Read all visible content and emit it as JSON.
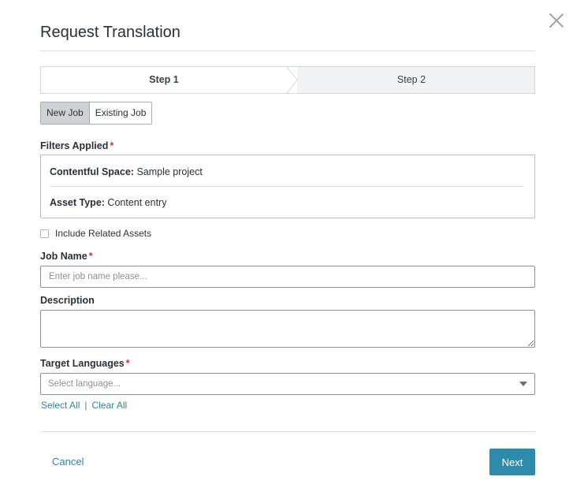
{
  "dialog": {
    "title": "Request Translation",
    "close_icon": "close-icon"
  },
  "steps": [
    {
      "label": "Step 1",
      "active": true
    },
    {
      "label": "Step 2",
      "active": false
    }
  ],
  "job_type_toggle": {
    "options": [
      "New Job",
      "Existing Job"
    ],
    "selected": "New Job"
  },
  "filters": {
    "label": "Filters Applied",
    "required_mark": "*",
    "rows": [
      {
        "key": "Contentful Space:",
        "value": "Sample project"
      },
      {
        "key": "Asset Type:",
        "value": "Content entry"
      }
    ]
  },
  "include_related": {
    "label": "Include Related Assets",
    "checked": false
  },
  "job_name": {
    "label": "Job Name",
    "required_mark": "*",
    "placeholder": "Enter job name please...",
    "value": ""
  },
  "description": {
    "label": "Description",
    "value": ""
  },
  "target_languages": {
    "label": "Target Languages",
    "required_mark": "*",
    "placeholder": "Select language...",
    "select_all": "Select All",
    "separator": "|",
    "clear_all": "Clear All"
  },
  "footer": {
    "cancel_label": "Cancel",
    "next_label": "Next"
  },
  "colors": {
    "accent": "#2e8bac",
    "link": "#2a85a8",
    "required": "#d0313a"
  }
}
